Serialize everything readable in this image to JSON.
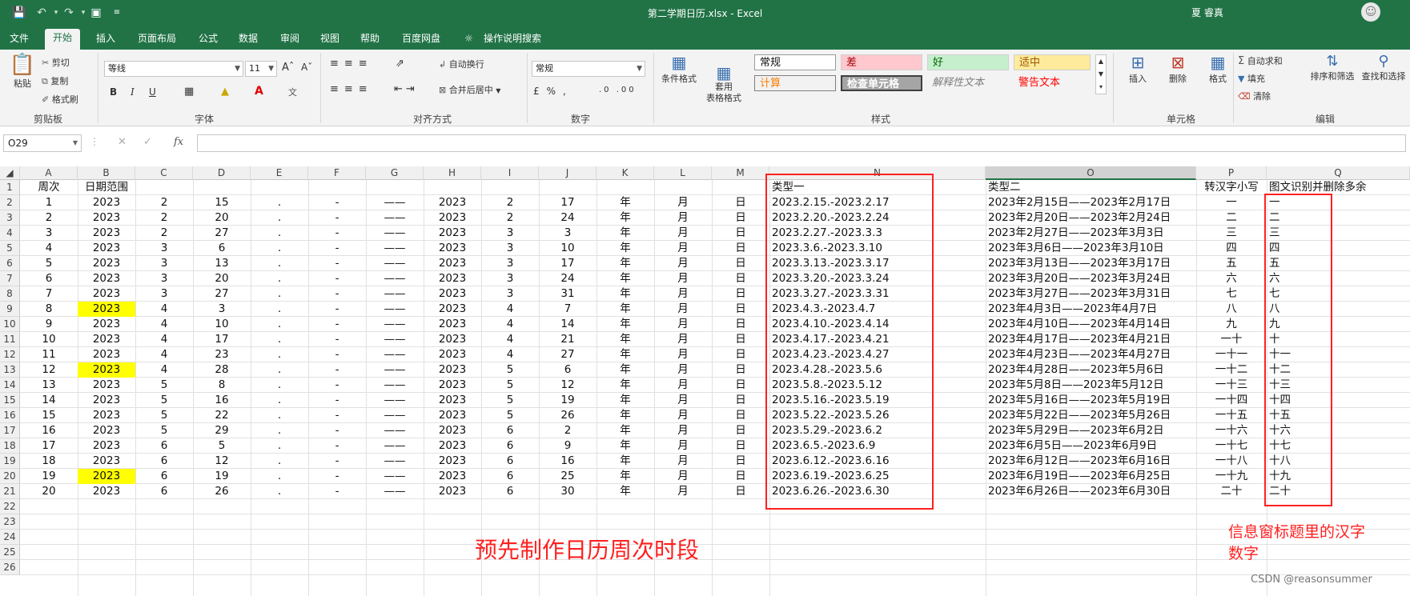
{
  "window": {
    "title": "第二学期日历.xlsx  -  Excel",
    "user": "夏 睿真",
    "accent": "#217346"
  },
  "tabs": [
    "文件",
    "开始",
    "插入",
    "页面布局",
    "公式",
    "数据",
    "审阅",
    "视图",
    "帮助",
    "百度网盘",
    "操作说明搜索"
  ],
  "active_tab": "开始",
  "ribbon": {
    "clipboard": {
      "paste": "粘贴",
      "cut": "剪切",
      "copy": "复制",
      "format_painter": "格式刷",
      "label": "剪贴板"
    },
    "font": {
      "name": "等线",
      "size": "11",
      "bold": "B",
      "italic": "I",
      "underline": "U",
      "label": "字体"
    },
    "alignment": {
      "wrap": "自动换行",
      "merge": "合并后居中",
      "label": "对齐方式"
    },
    "number": {
      "format": "常规",
      "label": "数字"
    },
    "styles": {
      "conditional": "条件格式",
      "table_format": "套用\n表格格式",
      "cells": [
        "常规",
        "差",
        "好",
        "适中",
        "计算",
        "检查单元格",
        "解释性文本",
        "警告文本"
      ],
      "label": "样式"
    },
    "cells_group": {
      "insert": "插入",
      "delete": "删除",
      "format": "格式",
      "label": "单元格"
    },
    "editing": {
      "autosum": "自动求和",
      "fill": "填充",
      "clear": "清除",
      "sort": "排序和筛选",
      "find": "查找和选择",
      "label": "编辑"
    }
  },
  "formula_bar": {
    "name_box": "O29",
    "fx": "fx",
    "formula": ""
  },
  "columns": [
    "A",
    "B",
    "C",
    "D",
    "E",
    "F",
    "G",
    "H",
    "I",
    "J",
    "K",
    "L",
    "M",
    "N",
    "O",
    "P",
    "Q"
  ],
  "rows": [
    "1",
    "2",
    "3",
    "4",
    "5",
    "6",
    "7",
    "8",
    "9",
    "10",
    "11",
    "12",
    "13",
    "14",
    "15",
    "16",
    "17",
    "18",
    "19",
    "20",
    "21",
    "22",
    "23",
    "24",
    "25",
    "26"
  ],
  "header_row": {
    "A": "周次",
    "B": "日期范围",
    "N": "类型一",
    "O": "类型二",
    "P": "转汉字小写",
    "Q": "图文识别并删除多余"
  },
  "data_rows": [
    {
      "A": "1",
      "B": "2023",
      "C": "2",
      "D": "15",
      "E": ".",
      "F": "-",
      "G": "——",
      "H": "2023",
      "I": "2",
      "J": "17",
      "K": "年",
      "L": "月",
      "M": "日",
      "N": "2023.2.15.-2023.2.17",
      "O": "2023年2月15日——2023年2月17日",
      "P": "一",
      "Q": "一",
      "hl": false
    },
    {
      "A": "2",
      "B": "2023",
      "C": "2",
      "D": "20",
      "E": ".",
      "F": "-",
      "G": "——",
      "H": "2023",
      "I": "2",
      "J": "24",
      "K": "年",
      "L": "月",
      "M": "日",
      "N": "2023.2.20.-2023.2.24",
      "O": "2023年2月20日——2023年2月24日",
      "P": "二",
      "Q": "二",
      "hl": false
    },
    {
      "A": "3",
      "B": "2023",
      "C": "2",
      "D": "27",
      "E": ".",
      "F": "-",
      "G": "——",
      "H": "2023",
      "I": "3",
      "J": "3",
      "K": "年",
      "L": "月",
      "M": "日",
      "N": "2023.2.27.-2023.3.3",
      "O": "2023年2月27日——2023年3月3日",
      "P": "三",
      "Q": "三",
      "hl": false
    },
    {
      "A": "4",
      "B": "2023",
      "C": "3",
      "D": "6",
      "E": ".",
      "F": "-",
      "G": "——",
      "H": "2023",
      "I": "3",
      "J": "10",
      "K": "年",
      "L": "月",
      "M": "日",
      "N": "2023.3.6.-2023.3.10",
      "O": "2023年3月6日——2023年3月10日",
      "P": "四",
      "Q": "四",
      "hl": false
    },
    {
      "A": "5",
      "B": "2023",
      "C": "3",
      "D": "13",
      "E": ".",
      "F": "-",
      "G": "——",
      "H": "2023",
      "I": "3",
      "J": "17",
      "K": "年",
      "L": "月",
      "M": "日",
      "N": "2023.3.13.-2023.3.17",
      "O": "2023年3月13日——2023年3月17日",
      "P": "五",
      "Q": "五",
      "hl": false
    },
    {
      "A": "6",
      "B": "2023",
      "C": "3",
      "D": "20",
      "E": ".",
      "F": "-",
      "G": "——",
      "H": "2023",
      "I": "3",
      "J": "24",
      "K": "年",
      "L": "月",
      "M": "日",
      "N": "2023.3.20.-2023.3.24",
      "O": "2023年3月20日——2023年3月24日",
      "P": "六",
      "Q": "六",
      "hl": false
    },
    {
      "A": "7",
      "B": "2023",
      "C": "3",
      "D": "27",
      "E": ".",
      "F": "-",
      "G": "——",
      "H": "2023",
      "I": "3",
      "J": "31",
      "K": "年",
      "L": "月",
      "M": "日",
      "N": "2023.3.27.-2023.3.31",
      "O": "2023年3月27日——2023年3月31日",
      "P": "七",
      "Q": "七",
      "hl": false
    },
    {
      "A": "8",
      "B": "2023",
      "C": "4",
      "D": "3",
      "E": ".",
      "F": "-",
      "G": "——",
      "H": "2023",
      "I": "4",
      "J": "7",
      "K": "年",
      "L": "月",
      "M": "日",
      "N": "2023.4.3.-2023.4.7",
      "O": "2023年4月3日——2023年4月7日",
      "P": "八",
      "Q": "八",
      "hl": true
    },
    {
      "A": "9",
      "B": "2023",
      "C": "4",
      "D": "10",
      "E": ".",
      "F": "-",
      "G": "——",
      "H": "2023",
      "I": "4",
      "J": "14",
      "K": "年",
      "L": "月",
      "M": "日",
      "N": "2023.4.10.-2023.4.14",
      "O": "2023年4月10日——2023年4月14日",
      "P": "九",
      "Q": "九",
      "hl": false
    },
    {
      "A": "10",
      "B": "2023",
      "C": "4",
      "D": "17",
      "E": ".",
      "F": "-",
      "G": "——",
      "H": "2023",
      "I": "4",
      "J": "21",
      "K": "年",
      "L": "月",
      "M": "日",
      "N": "2023.4.17.-2023.4.21",
      "O": "2023年4月17日——2023年4月21日",
      "P": "一十",
      "Q": "十",
      "hl": false
    },
    {
      "A": "11",
      "B": "2023",
      "C": "4",
      "D": "23",
      "E": ".",
      "F": "-",
      "G": "——",
      "H": "2023",
      "I": "4",
      "J": "27",
      "K": "年",
      "L": "月",
      "M": "日",
      "N": "2023.4.23.-2023.4.27",
      "O": "2023年4月23日——2023年4月27日",
      "P": "一十一",
      "Q": "十一",
      "hl": false
    },
    {
      "A": "12",
      "B": "2023",
      "C": "4",
      "D": "28",
      "E": ".",
      "F": "-",
      "G": "——",
      "H": "2023",
      "I": "5",
      "J": "6",
      "K": "年",
      "L": "月",
      "M": "日",
      "N": "2023.4.28.-2023.5.6",
      "O": "2023年4月28日——2023年5月6日",
      "P": "一十二",
      "Q": "十二",
      "hl": true
    },
    {
      "A": "13",
      "B": "2023",
      "C": "5",
      "D": "8",
      "E": ".",
      "F": "-",
      "G": "——",
      "H": "2023",
      "I": "5",
      "J": "12",
      "K": "年",
      "L": "月",
      "M": "日",
      "N": "2023.5.8.-2023.5.12",
      "O": "2023年5月8日——2023年5月12日",
      "P": "一十三",
      "Q": "十三",
      "hl": false
    },
    {
      "A": "14",
      "B": "2023",
      "C": "5",
      "D": "16",
      "E": ".",
      "F": "-",
      "G": "——",
      "H": "2023",
      "I": "5",
      "J": "19",
      "K": "年",
      "L": "月",
      "M": "日",
      "N": "2023.5.16.-2023.5.19",
      "O": "2023年5月16日——2023年5月19日",
      "P": "一十四",
      "Q": "十四",
      "hl": false
    },
    {
      "A": "15",
      "B": "2023",
      "C": "5",
      "D": "22",
      "E": ".",
      "F": "-",
      "G": "——",
      "H": "2023",
      "I": "5",
      "J": "26",
      "K": "年",
      "L": "月",
      "M": "日",
      "N": "2023.5.22.-2023.5.26",
      "O": "2023年5月22日——2023年5月26日",
      "P": "一十五",
      "Q": "十五",
      "hl": false
    },
    {
      "A": "16",
      "B": "2023",
      "C": "5",
      "D": "29",
      "E": ".",
      "F": "-",
      "G": "——",
      "H": "2023",
      "I": "6",
      "J": "2",
      "K": "年",
      "L": "月",
      "M": "日",
      "N": "2023.5.29.-2023.6.2",
      "O": "2023年5月29日——2023年6月2日",
      "P": "一十六",
      "Q": "十六",
      "hl": false
    },
    {
      "A": "17",
      "B": "2023",
      "C": "6",
      "D": "5",
      "E": ".",
      "F": "-",
      "G": "——",
      "H": "2023",
      "I": "6",
      "J": "9",
      "K": "年",
      "L": "月",
      "M": "日",
      "N": "2023.6.5.-2023.6.9",
      "O": "2023年6月5日——2023年6月9日",
      "P": "一十七",
      "Q": "十七",
      "hl": false
    },
    {
      "A": "18",
      "B": "2023",
      "C": "6",
      "D": "12",
      "E": ".",
      "F": "-",
      "G": "——",
      "H": "2023",
      "I": "6",
      "J": "16",
      "K": "年",
      "L": "月",
      "M": "日",
      "N": "2023.6.12.-2023.6.16",
      "O": "2023年6月12日——2023年6月16日",
      "P": "一十八",
      "Q": "十八",
      "hl": false
    },
    {
      "A": "19",
      "B": "2023",
      "C": "6",
      "D": "19",
      "E": ".",
      "F": "-",
      "G": "——",
      "H": "2023",
      "I": "6",
      "J": "25",
      "K": "年",
      "L": "月",
      "M": "日",
      "N": "2023.6.19.-2023.6.25",
      "O": "2023年6月19日——2023年6月25日",
      "P": "一十九",
      "Q": "十九",
      "hl": true
    },
    {
      "A": "20",
      "B": "2023",
      "C": "6",
      "D": "26",
      "E": ".",
      "F": "-",
      "G": "——",
      "H": "2023",
      "I": "6",
      "J": "30",
      "K": "年",
      "L": "月",
      "M": "日",
      "N": "2023.6.26.-2023.6.30",
      "O": "2023年6月26日——2023年6月30日",
      "P": "二十",
      "Q": "二十",
      "hl": false
    }
  ],
  "annotations": {
    "main": "预先制作日历周次时段",
    "side_line1": "信息窗标题里的汉字",
    "side_line2": "数字",
    "color": "#ff2020"
  },
  "highlight_color": "#ffff00",
  "watermark": "CSDN @reasonsummer"
}
